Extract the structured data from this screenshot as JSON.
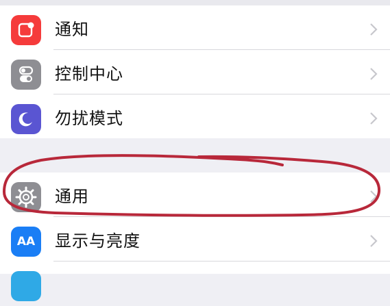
{
  "settings": {
    "group1": [
      {
        "label": "通知",
        "icon": "notifications-icon",
        "color": "#f53b3b"
      },
      {
        "label": "控制中心",
        "icon": "control-center-icon",
        "color": "#8e8e93"
      },
      {
        "label": "勿扰模式",
        "icon": "do-not-disturb-icon",
        "color": "#5a55d2"
      }
    ],
    "group2": [
      {
        "label": "通用",
        "icon": "gear-icon",
        "color": "#8e8e93",
        "highlighted": true
      },
      {
        "label": "显示与亮度",
        "icon": "display-brightness-icon",
        "color": "#1a7ef5",
        "glyph": "AA"
      },
      {
        "label": "",
        "icon": "partial-row-icon",
        "color": "#2fa9e6"
      }
    ]
  },
  "annotation": {
    "type": "hand-drawn-circle",
    "color": "#b8283a",
    "target": "通用"
  }
}
